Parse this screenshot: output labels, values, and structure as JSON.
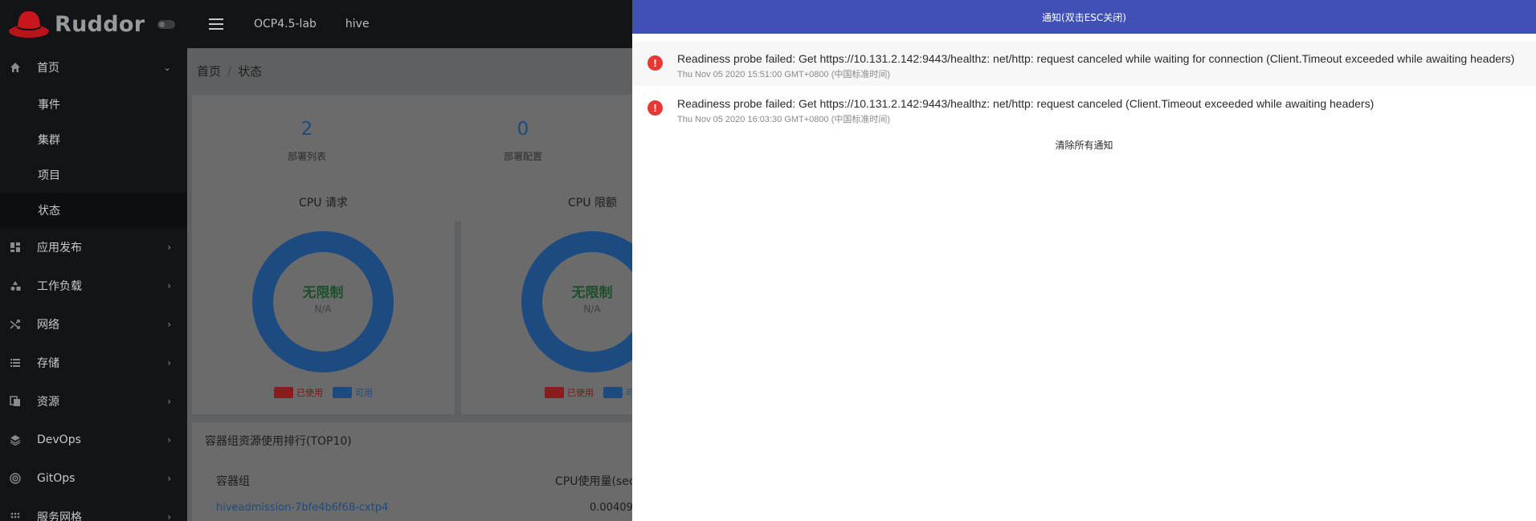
{
  "brand": {
    "name": "Ruddor"
  },
  "sidebar": {
    "items": [
      {
        "label": "首页",
        "icon": "home-icon"
      },
      {
        "label": "应用发布",
        "icon": "dashboard-icon"
      },
      {
        "label": "工作负载",
        "icon": "shapes-icon"
      },
      {
        "label": "网络",
        "icon": "shuffle-icon"
      },
      {
        "label": "存储",
        "icon": "list-icon"
      },
      {
        "label": "资源",
        "icon": "files-icon"
      },
      {
        "label": "DevOps",
        "icon": "layers-icon"
      },
      {
        "label": "GitOps",
        "icon": "radar-icon"
      },
      {
        "label": "服务网格",
        "icon": "grid-icon"
      }
    ],
    "subitems": [
      "事件",
      "集群",
      "项目",
      "状态"
    ]
  },
  "topbar": {
    "cluster": "OCP4.5-lab",
    "project": "hive"
  },
  "breadcrumb": {
    "home": "首页",
    "sep": "/",
    "current": "状态"
  },
  "stats": [
    {
      "value": "2",
      "label": "部署列表"
    },
    {
      "value": "0",
      "label": "部署配置"
    }
  ],
  "charts": [
    {
      "title": "CPU 请求",
      "center": "无限制",
      "sub": "N/A",
      "used": "已使用",
      "available": "可用"
    },
    {
      "title": "CPU 限额",
      "center": "无限制",
      "sub": "N/A",
      "used": "已使用",
      "available": "可"
    }
  ],
  "table": {
    "title": "容器组资源使用排行(TOP10)",
    "col1": "容器组",
    "col2": "CPU使用量(sec)",
    "row_link": "hiveadmission-7bfe4b6f68-cxtp4",
    "row_value": "0.00409"
  },
  "drawer": {
    "header": "通知(双击ESC关闭)",
    "notices": [
      {
        "message": "Readiness probe failed: Get https://10.131.2.142:9443/healthz: net/http: request canceled while waiting for connection (Client.Timeout exceeded while awaiting headers)",
        "time": "Thu Nov 05 2020 15:51:00 GMT+0800 (中国标准时间)"
      },
      {
        "message": "Readiness probe failed: Get https://10.131.2.142:9443/healthz: net/http: request canceled (Client.Timeout exceeded while awaiting headers)",
        "time": "Thu Nov 05 2020 16:03:30 GMT+0800 (中国标准时间)"
      }
    ],
    "clear_all": "清除所有通知"
  },
  "colors": {
    "drawer_header": "#3f51b5",
    "error": "#e53935",
    "used": "#8b1c1c",
    "available": "#1c4b82"
  }
}
